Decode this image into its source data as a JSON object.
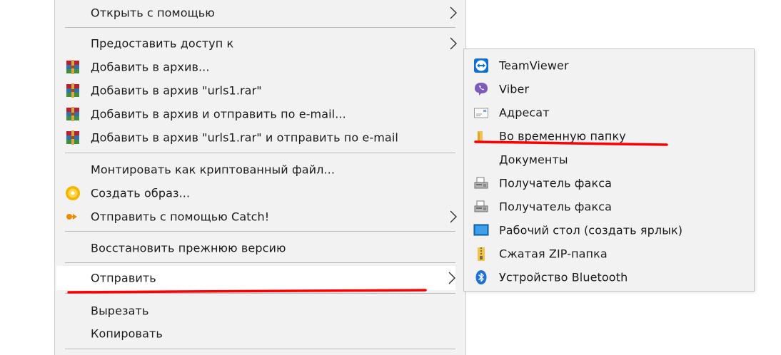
{
  "menu": {
    "items": [
      {
        "label": "Открыть с помощью",
        "icon": "",
        "submenu": true
      },
      {
        "label": "Предоставить доступ к",
        "icon": "",
        "submenu": true
      },
      {
        "label": "Добавить в архив...",
        "icon": "winrar-icon"
      },
      {
        "label": "Добавить в архив \"urls1.rar\"",
        "icon": "winrar-icon"
      },
      {
        "label": "Добавить в архив и отправить по e-mail...",
        "icon": "winrar-icon"
      },
      {
        "label": "Добавить в архив \"urls1.rar\" и отправить по e-mail",
        "icon": "winrar-icon"
      },
      {
        "label": "Монтировать как криптованный файл...",
        "icon": ""
      },
      {
        "label": "Создать образ...",
        "icon": "disc-icon"
      },
      {
        "label": "Отправить с помощью Catch!",
        "icon": "catch-icon",
        "submenu": true
      },
      {
        "label": "Восстановить прежнюю версию",
        "icon": ""
      },
      {
        "label": "Отправить",
        "icon": "",
        "submenu": true,
        "highlighted": true
      },
      {
        "label": "Вырезать",
        "icon": ""
      },
      {
        "label": "Копировать",
        "icon": ""
      }
    ]
  },
  "submenu": {
    "items": [
      {
        "label": "TeamViewer",
        "icon": "teamviewer-icon"
      },
      {
        "label": "Viber",
        "icon": "viber-icon"
      },
      {
        "label": "Адресат",
        "icon": "mail-recipient-icon"
      },
      {
        "label": "Во временную папку",
        "icon": "folder-icon"
      },
      {
        "label": "Документы",
        "icon": "documents-icon"
      },
      {
        "label": "Получатель факса",
        "icon": "fax-icon"
      },
      {
        "label": "Получатель факса",
        "icon": "fax-icon"
      },
      {
        "label": "Рабочий стол (создать ярлык)",
        "icon": "desktop-icon"
      },
      {
        "label": "Сжатая ZIP-папка",
        "icon": "zip-folder-icon"
      },
      {
        "label": "Устройство Bluetooth",
        "icon": "bluetooth-icon"
      }
    ]
  },
  "colors": {
    "menu_bg": "#f2f2f2",
    "highlight_bg": "#ffffff",
    "annotation": "#ff0000",
    "separator": "#b9b9b9"
  }
}
